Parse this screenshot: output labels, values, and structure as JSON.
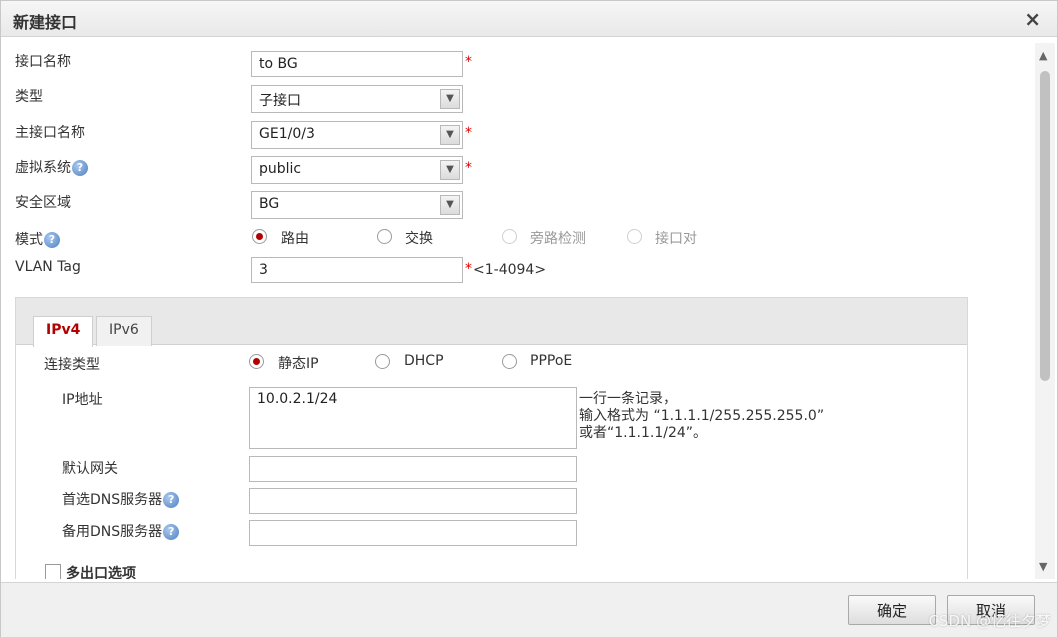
{
  "dialog": {
    "title": "新建接口",
    "close_glyph": "×"
  },
  "form": {
    "interface_name": {
      "label": "接口名称",
      "value": "to BG",
      "required": "*"
    },
    "type": {
      "label": "类型",
      "value": "子接口"
    },
    "main_interface": {
      "label": "主接口名称",
      "value": "GE1/0/3",
      "required": "*"
    },
    "virtual_system": {
      "label": "虚拟系统",
      "value": "public",
      "required": "*",
      "help": "?"
    },
    "security_zone": {
      "label": "安全区域",
      "value": "BG"
    },
    "mode": {
      "label": "模式",
      "help": "?",
      "options": [
        "路由",
        "交换",
        "旁路检测",
        "接口对"
      ],
      "selected": "路由"
    },
    "vlan_tag": {
      "label": "VLAN Tag",
      "value": "3",
      "required": "*",
      "range": "<1-4094>"
    }
  },
  "tabs": {
    "ipv4": "IPv4",
    "ipv6": "IPv6",
    "active": "IPv4"
  },
  "ipv4": {
    "connection_type": {
      "label": "连接类型",
      "options": [
        "静态IP",
        "DHCP",
        "PPPoE"
      ],
      "selected": "静态IP"
    },
    "ip_address": {
      "label": "IP地址",
      "value": "10.0.2.1/24",
      "hint_line1": "一行一条记录，",
      "hint_line2": "输入格式为 “1.1.1.1/255.255.255.0”",
      "hint_line3": "或者“1.1.1.1/24”。"
    },
    "default_gateway": {
      "label": "默认网关",
      "value": ""
    },
    "primary_dns": {
      "label": "首选DNS服务器",
      "value": "",
      "help": "?"
    },
    "secondary_dns": {
      "label": "备用DNS服务器",
      "value": "",
      "help": "?"
    },
    "multi_egress": {
      "label": "多出口选项"
    }
  },
  "footer": {
    "ok": "确定",
    "cancel": "取消"
  },
  "watermark": "CSDN @忆往夕梦",
  "scroll": {
    "up": "▲",
    "down": "▼"
  },
  "select_arrow": "▼",
  "colors": {
    "accent": "#b30000",
    "required": "#dd0000",
    "help_icon": "#4f7fbf"
  }
}
